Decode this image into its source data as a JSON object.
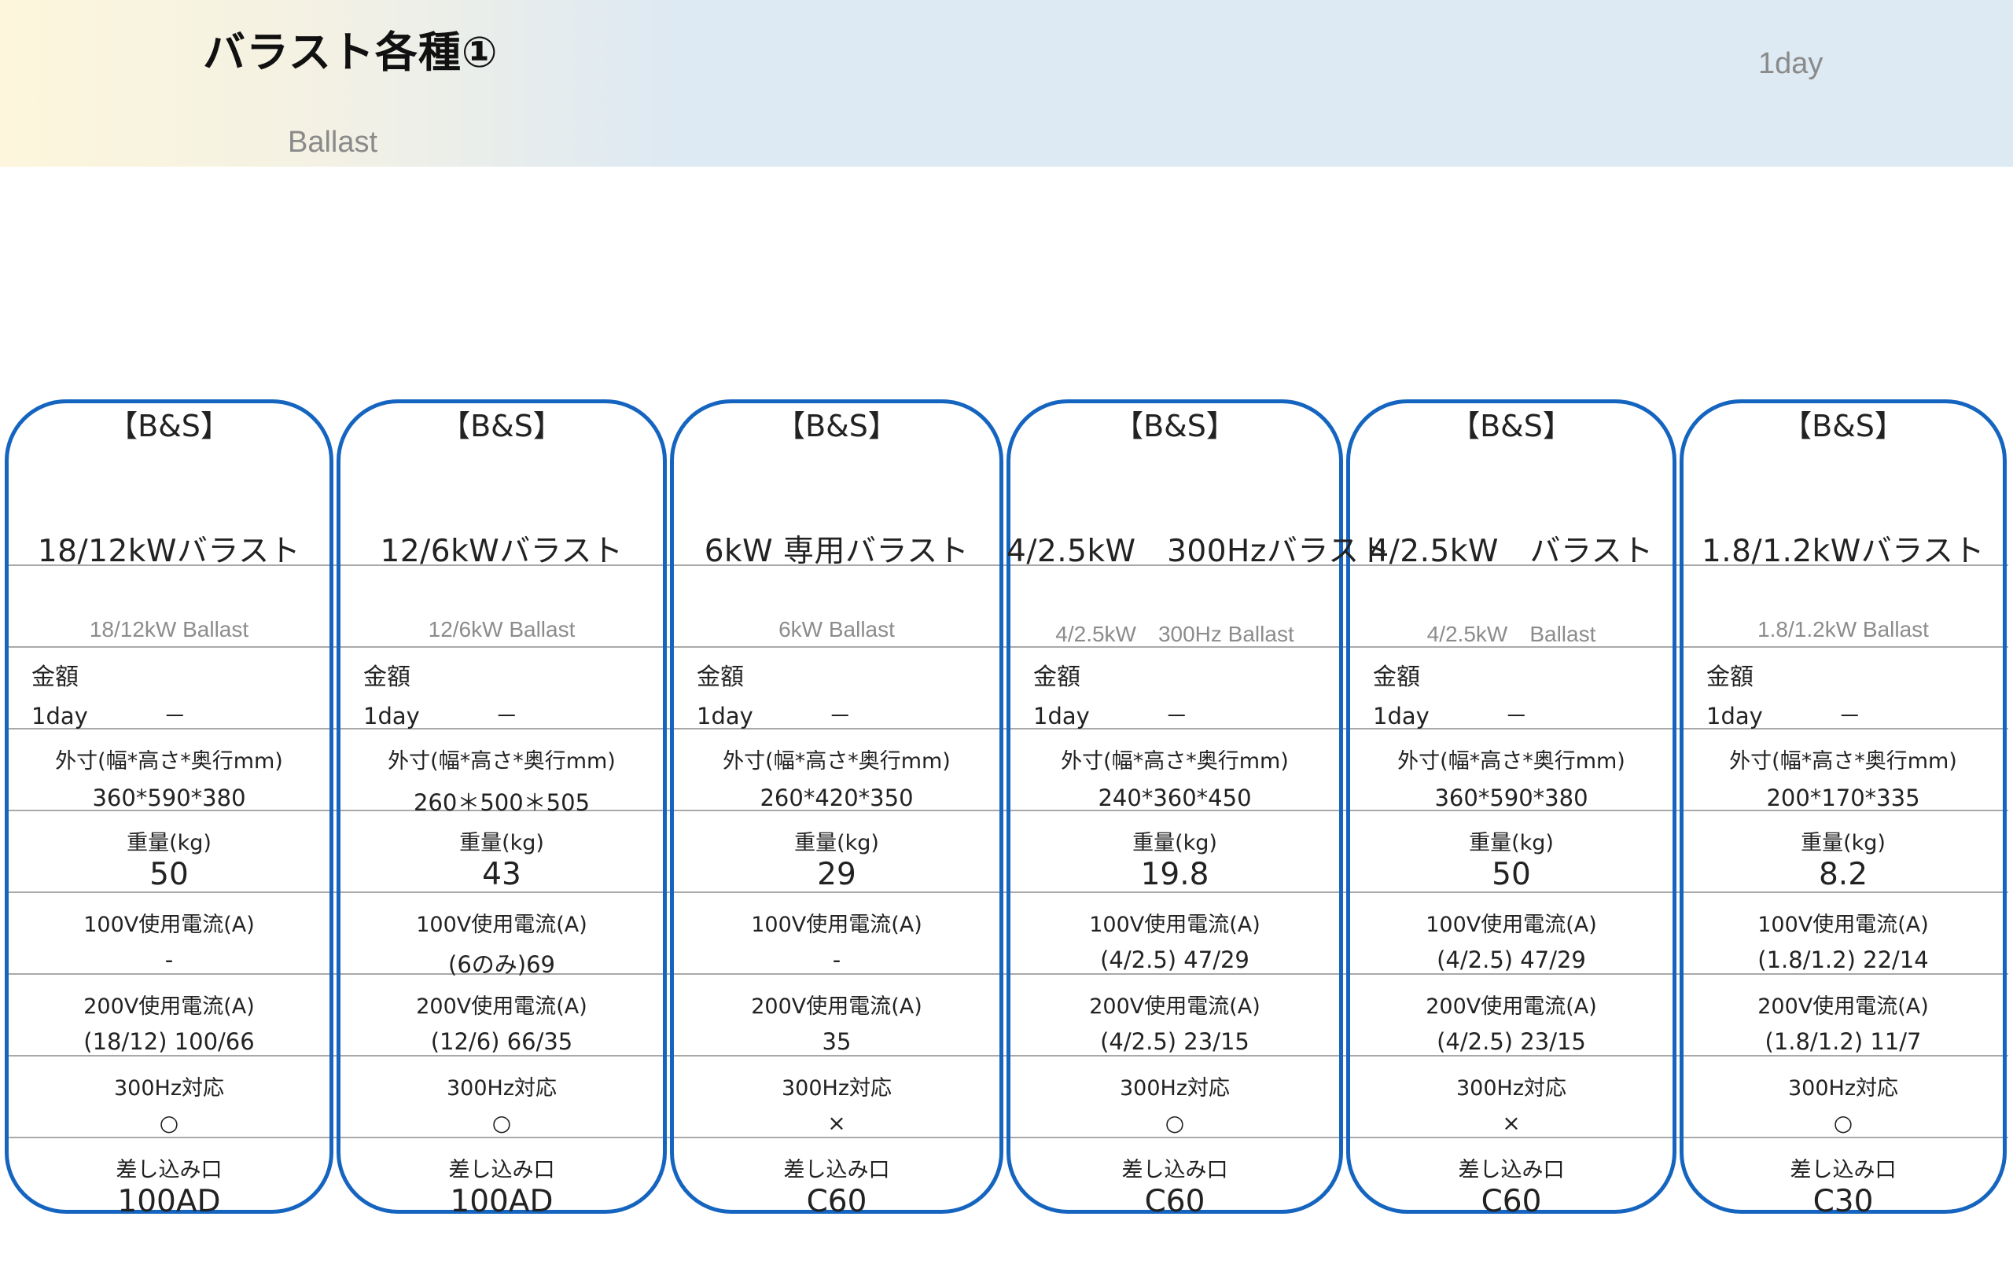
{
  "header": {
    "title": "バラスト各種①",
    "subtitle": "Ballast",
    "period": "1day"
  },
  "labels": {
    "price": "金額",
    "period": "1day",
    "dimensions": "外寸(幅*高さ*奥行mm)",
    "weight": "重量(kg)",
    "current_100v": "100V使用電流(A)",
    "current_200v": "200V使用電流(A)",
    "hz300": "300Hz対応",
    "plug": "差し込み口"
  },
  "cards": [
    {
      "brand": "【B&S】",
      "name": "18/12kWバラスト",
      "name_en": "18/12kW Ballast",
      "price": "－",
      "dimensions": "360*590*380",
      "weight": "50",
      "current_100v": "-",
      "current_200v": "(18/12) 100/66",
      "hz300": "○",
      "plug": "100AD"
    },
    {
      "brand": "【B&S】",
      "name": "12/6kWバラスト",
      "name_en": "12/6kW Ballast",
      "price": "－",
      "dimensions": "260＊500＊505",
      "weight": "43",
      "current_100v": "(6のみ)69",
      "current_200v": "(12/6) 66/35",
      "hz300": "○",
      "plug": "100AD"
    },
    {
      "brand": "【B&S】",
      "name": "6kW 専用バラスト",
      "name_en": "6kW Ballast",
      "price": "－",
      "dimensions": "260*420*350",
      "weight": "29",
      "current_100v": "-",
      "current_200v": "35",
      "hz300": "×",
      "plug": "C60"
    },
    {
      "brand": "【B&S】",
      "name": "4/2.5kW　300Hzバラスト",
      "name_en": "4/2.5kW　300Hz Ballast",
      "price": "－",
      "dimensions": "240*360*450",
      "weight": "19.8",
      "current_100v": "(4/2.5) 47/29",
      "current_200v": "(4/2.5) 23/15",
      "hz300": "○",
      "plug": "C60"
    },
    {
      "brand": "【B&S】",
      "name": "4/2.5kW　バラスト",
      "name_en": "4/2.5kW　Ballast",
      "price": "－",
      "dimensions": "360*590*380",
      "weight": "50",
      "current_100v": "(4/2.5) 47/29",
      "current_200v": "(4/2.5) 23/15",
      "hz300": "×",
      "plug": "C60"
    },
    {
      "brand": "【B&S】",
      "name": "1.8/1.2kWバラスト",
      "name_en": "1.8/1.2kW Ballast",
      "price": "－",
      "dimensions": "200*170*335",
      "weight": "8.2",
      "current_100v": "(1.8/1.2) 22/14",
      "current_200v": "(1.8/1.2) 11/7",
      "hz300": "○",
      "plug": "C30"
    }
  ],
  "colors": {
    "card_border": "#1565c0",
    "row_line": "#a9a9a9",
    "header_band": "#dde9f3"
  }
}
